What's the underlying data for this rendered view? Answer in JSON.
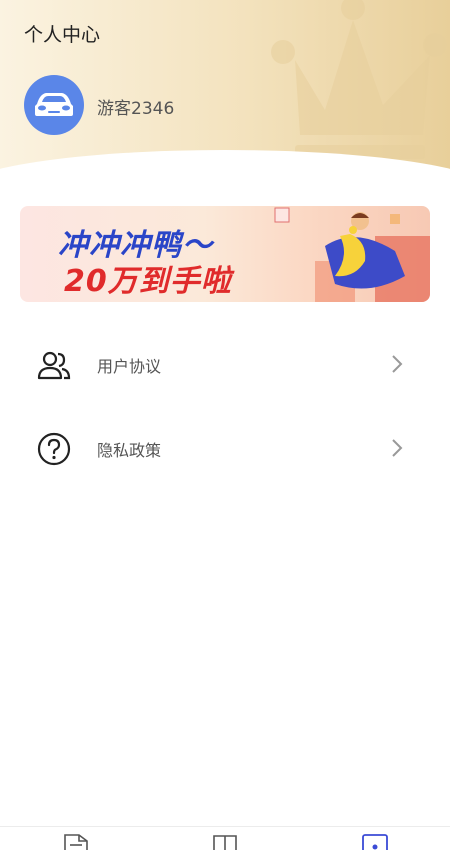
{
  "header": {
    "title": "个人中心",
    "username": "游客2346"
  },
  "banner": {
    "line1": "冲冲冲鸭～",
    "line2": "20万到手啦"
  },
  "menu": [
    {
      "label": "用户协议",
      "icon": "users-icon"
    },
    {
      "label": "隐私政策",
      "icon": "question-circle-icon"
    }
  ],
  "tabbar": {
    "tabs": [
      {
        "icon": "document-icon",
        "selected": false
      },
      {
        "icon": "book-icon",
        "selected": false
      },
      {
        "icon": "profile-icon",
        "selected": true
      }
    ]
  },
  "colors": {
    "avatar_bg": "#5a86e8",
    "accent_blue": "#2a45c8",
    "accent_red": "#e02b2b"
  }
}
